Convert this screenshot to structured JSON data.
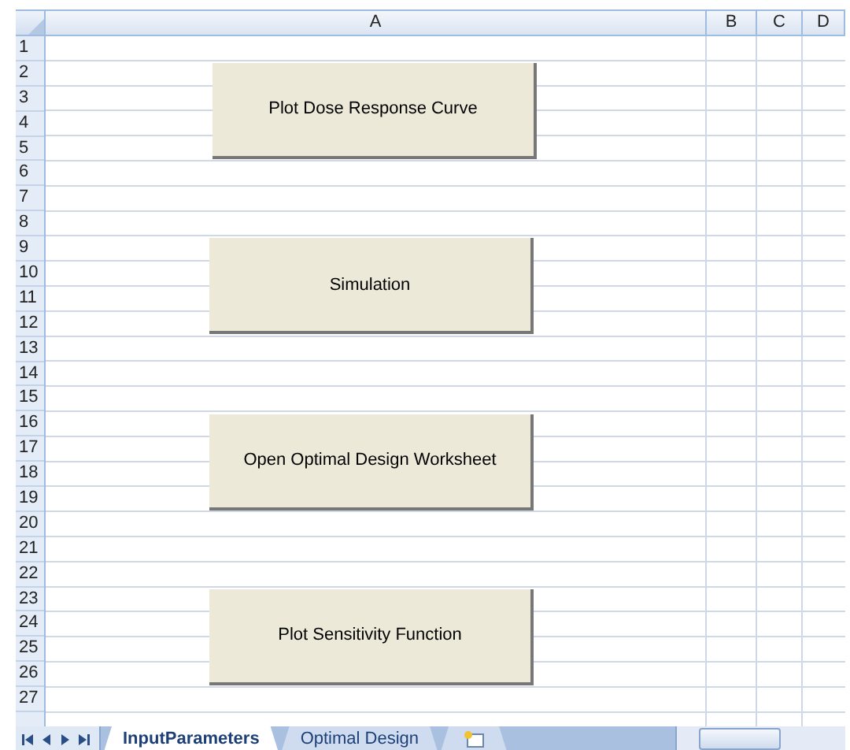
{
  "sheet": {
    "columns": [
      "A",
      "B",
      "C",
      "D"
    ],
    "rows": [
      "1",
      "2",
      "3",
      "4",
      "5",
      "6",
      "7",
      "8",
      "9",
      "10",
      "11",
      "12",
      "13",
      "14",
      "15",
      "16",
      "17",
      "18",
      "19",
      "20",
      "21",
      "22",
      "23",
      "24",
      "25",
      "26",
      "27"
    ]
  },
  "buttons": [
    {
      "label": "Plot Dose Response Curve"
    },
    {
      "label": "Simulation"
    },
    {
      "label": "Open Optimal Design Worksheet"
    },
    {
      "label": "Plot Sensitivity Function"
    }
  ],
  "tabs": [
    {
      "label": "InputParameters",
      "selected": true
    },
    {
      "label": "Optimal Design",
      "selected": false
    }
  ]
}
